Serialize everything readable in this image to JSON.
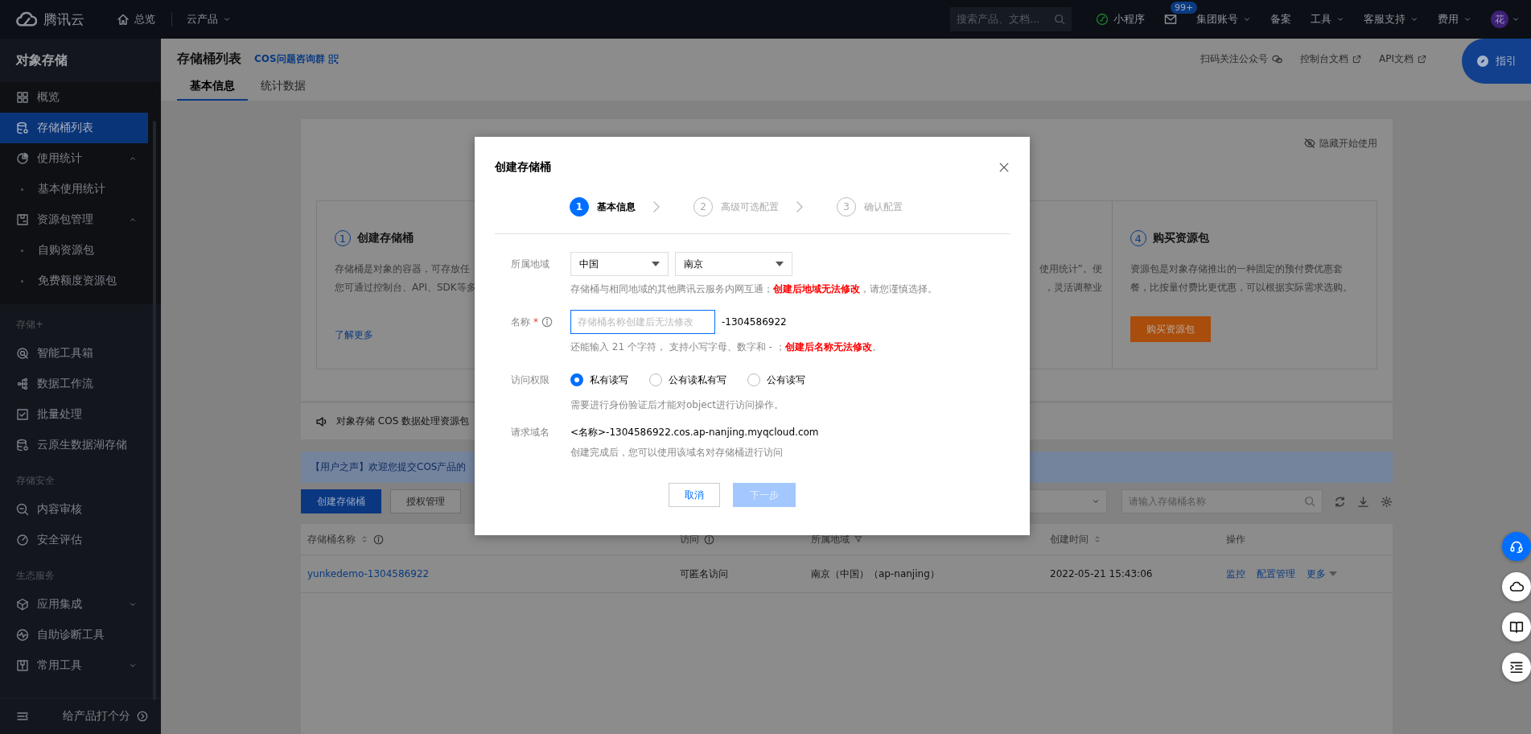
{
  "topbar": {
    "logo": "腾讯云",
    "nav": [
      {
        "label": "总览",
        "kind": "home"
      },
      {
        "label": "云产品",
        "kind": "dropdown"
      }
    ],
    "search": {
      "placeholder": "搜索产品、文档..."
    },
    "items": [
      {
        "label": "小程序",
        "kind": "miniapp"
      },
      {
        "kind": "mail",
        "badge": "99+"
      },
      {
        "label": "集团账号",
        "kind": "dropdown"
      },
      {
        "label": "备案",
        "kind": "plain"
      },
      {
        "label": "工具",
        "kind": "dropdown"
      },
      {
        "label": "客服支持",
        "kind": "dropdown"
      },
      {
        "label": "费用",
        "kind": "dropdown"
      }
    ],
    "avatar": "花"
  },
  "sidebar": {
    "title": "对象存储",
    "groups": [
      {
        "items": [
          {
            "label": "概览",
            "selected": false
          },
          {
            "label": "存储桶列表",
            "selected": true
          },
          {
            "label": "使用统计",
            "selected": false,
            "expanded": true,
            "children": [
              {
                "label": "基本使用统计",
                "selected": false
              }
            ]
          },
          {
            "label": "资源包管理",
            "selected": false,
            "expanded": true,
            "children": [
              {
                "label": "自购资源包",
                "selected": false
              },
              {
                "label": "免费额度资源包",
                "selected": false
              }
            ]
          }
        ]
      },
      {
        "label": "存储+",
        "items": [
          {
            "label": "智能工具箱",
            "selected": false
          },
          {
            "label": "数据工作流",
            "selected": false
          },
          {
            "label": "批量处理",
            "selected": false
          },
          {
            "label": "云原生数据湖存储",
            "selected": false
          }
        ]
      },
      {
        "label": "存储安全",
        "items": [
          {
            "label": "内容审核",
            "selected": false
          },
          {
            "label": "安全评估",
            "selected": false
          }
        ]
      },
      {
        "label": "生态服务",
        "items": [
          {
            "label": "应用集成",
            "selected": false,
            "expanded": false
          },
          {
            "label": "自助诊断工具",
            "selected": false
          },
          {
            "label": "常用工具",
            "selected": false,
            "expanded": false
          }
        ]
      }
    ],
    "footer": "给产品打个分"
  },
  "page": {
    "title": "存储桶列表",
    "qr_link": "COS问题咨询群",
    "header_links": [
      {
        "label": "扫码关注公众号",
        "kind": "wechat"
      },
      {
        "label": "控制台文档",
        "kind": "external"
      },
      {
        "label": "API文档",
        "kind": "external"
      }
    ],
    "guide_button": "指引",
    "tabs": [
      {
        "label": "基本信息",
        "selected": true
      },
      {
        "label": "统计数据",
        "selected": false
      }
    ]
  },
  "getting_started": {
    "hide_link": "隐藏开始使用",
    "steps": [
      {
        "number": "1",
        "title": "创建存储桶",
        "lines": [
          "存储桶是对象的容器，可存放任",
          "您可通过控制台、API、SDK等多"
        ],
        "link": "了解更多"
      },
      {
        "lines": [
          "使用统计”。便",
          "，灵活调整业"
        ]
      },
      {
        "number": "4",
        "title": "购买资源包",
        "lines": [
          "资源包是对象存储推出的一种固定的预付费优惠套",
          "餐，比按量付费比更优惠，可以根据实际需求选购。"
        ],
        "button": "购买资源包"
      }
    ]
  },
  "notice": {
    "text": "对象存储 COS 数据处理资源包"
  },
  "voice_banner": {
    "text": "【用户之声】欢迎您提交COS产品的"
  },
  "toolbar": {
    "buttons": [
      {
        "label": "创建存储桶",
        "kind": "primary"
      },
      {
        "label": "授权管理",
        "kind": "default"
      }
    ],
    "search": {
      "placeholder": "请输入存储桶名称"
    }
  },
  "table": {
    "columns": [
      "存储桶名称",
      "访问",
      "所属地域",
      "创建时间",
      "操作"
    ],
    "rows": [
      {
        "cells": [
          "yunkedemo-1304586922",
          "可匿名访问",
          "南京（中国）（ap-nanjing）",
          "2022-05-21 15:43:06"
        ],
        "actions": [
          "监控",
          "配置管理",
          "更多"
        ]
      }
    ]
  },
  "dialog": {
    "title": "创建存储桶",
    "steps": [
      {
        "number": "1",
        "label": "基本信息",
        "selected": true
      },
      {
        "number": "2",
        "label": "高级可选配置",
        "selected": false
      },
      {
        "number": "3",
        "label": "确认配置",
        "selected": false
      }
    ],
    "fields": [
      {
        "kind": "region",
        "label": "所属地域",
        "selects": [
          "中国",
          "南京"
        ],
        "hint": "存储桶与相同地域的其他腾讯云服务内网互通；**创建后地域无法修改**，请您谨慎选择。"
      },
      {
        "kind": "name",
        "label": "名称",
        "required_mark": "*",
        "placeholder": "存储桶名称创建后无法修改",
        "suffix": "-1304586922",
        "hint": "还能输入 21 个字符， 支持小写字母、数字和 - ；**创建后名称无法修改**。"
      },
      {
        "kind": "radio",
        "label": "访问权限",
        "options": [
          {
            "label": "私有读写",
            "selected": true
          },
          {
            "label": "公有读私有写",
            "selected": false
          },
          {
            "label": "公有读写",
            "selected": false
          }
        ],
        "hint": "需要进行身份验证后才能对object进行访问操作。"
      },
      {
        "kind": "text",
        "label": "请求域名",
        "value": "<名称>-1304586922.cos.ap-nanjing.myqcloud.com",
        "hint": "创建完成后，您可以使用该域名对存储桶进行访问"
      }
    ],
    "buttons": [
      {
        "label": "取消",
        "kind": "default",
        "disabled": false
      },
      {
        "label": "下一步",
        "kind": "primary",
        "disabled": true
      }
    ]
  }
}
